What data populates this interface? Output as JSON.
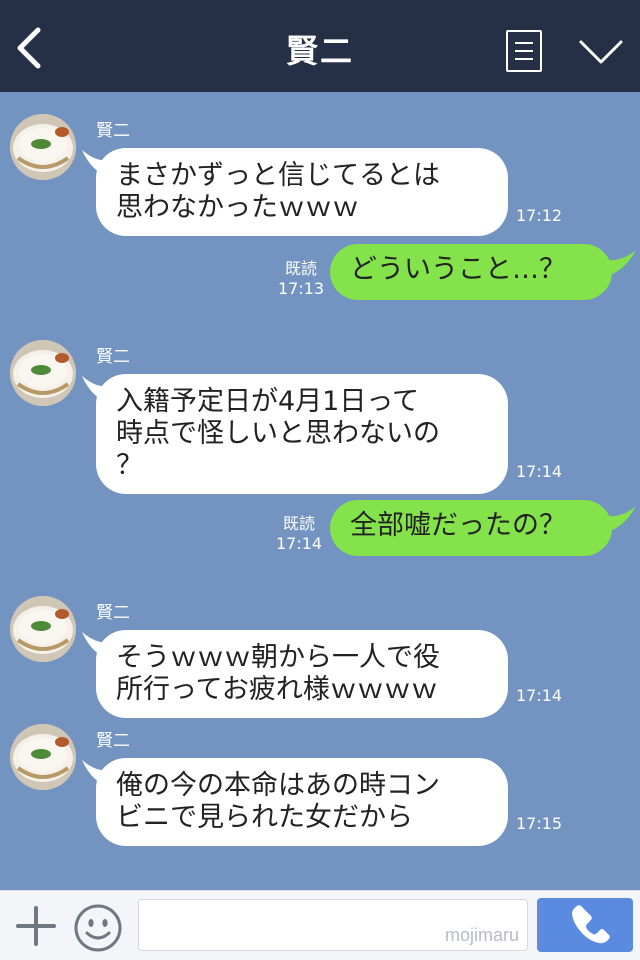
{
  "header": {
    "title": "賢二",
    "back_icon": "chevron-left-icon",
    "menu_icon": "list-icon",
    "dropdown_icon": "chevron-down-icon"
  },
  "colors": {
    "header_bg": "#253046",
    "chat_bg": "#7393c1",
    "incoming_bubble": "#ffffff",
    "outgoing_bubble": "#84e24b",
    "call_button": "#5b8be0"
  },
  "messages": [
    {
      "from": "賢二",
      "text": "まさかずっと信じてるとは\n思わなかったｗｗｗ",
      "time": "17:12"
    },
    {
      "from": "me",
      "read": "既読",
      "text": "どういうこと…？",
      "time": "17:13"
    },
    {
      "from": "賢二",
      "text": "入籍予定日が4月1日って\n時点で怪しいと思わないの\n？",
      "time": "17:14"
    },
    {
      "from": "me",
      "read": "既読",
      "text": "全部嘘だったの？",
      "time": "17:14"
    },
    {
      "from": "賢二",
      "text": "そうｗｗｗ朝から一人で役\n所行ってお疲れ様ｗｗｗｗ",
      "time": "17:14"
    },
    {
      "from": "賢二",
      "text": "俺の今の本命はあの時コン\nビニで見られた女だから",
      "time": "17:15"
    }
  ],
  "footer": {
    "add_icon": "plus-icon",
    "sticker_icon": "smiley-icon",
    "input_value": "",
    "watermark": "mojimaru",
    "call_icon": "phone-icon"
  }
}
